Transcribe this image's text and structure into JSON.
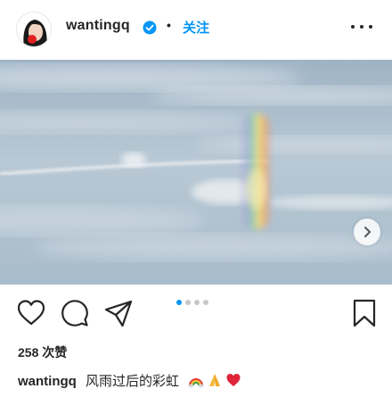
{
  "post": {
    "username": "wantingq",
    "verified": true,
    "separator": "•",
    "follow_label": "关注",
    "likes_text": "258 次赞",
    "caption_text": "风雨过后的彩虹",
    "caption_emojis": [
      "rainbow-emoji",
      "praying-hands-emoji",
      "red-heart-emoji"
    ],
    "carousel": {
      "count": 4,
      "active_index": 0
    }
  },
  "colors": {
    "accent": "#0095f6",
    "text": "#262626",
    "inactive_dot": "#c7c7c7"
  },
  "icons": {
    "like": "heart-outline-icon",
    "comment": "comment-bubble-icon",
    "share": "paper-plane-icon",
    "save": "bookmark-icon",
    "more": "ellipsis-icon",
    "next": "chevron-right-icon"
  }
}
